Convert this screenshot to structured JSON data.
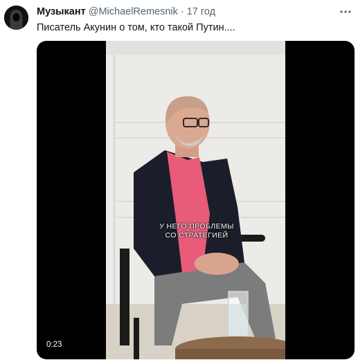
{
  "tweet": {
    "author_name": "Музыкант",
    "handle": "@MichaelRemesnik",
    "separator": "·",
    "time": "17 год",
    "text": "Писатель Акунин о том, кто такой Путин...."
  },
  "video": {
    "caption_line1": "У НЕГО ПРОБЛЕМЫ",
    "caption_line2": "СО СТРАТЕГИЕЙ",
    "timecode": "0:23"
  },
  "icons": {
    "avatar": "hooded-figure",
    "more": "more-dots-icon"
  },
  "colors": {
    "text_primary": "#0f1419",
    "text_secondary": "#536471",
    "video_bg": "#000000"
  }
}
